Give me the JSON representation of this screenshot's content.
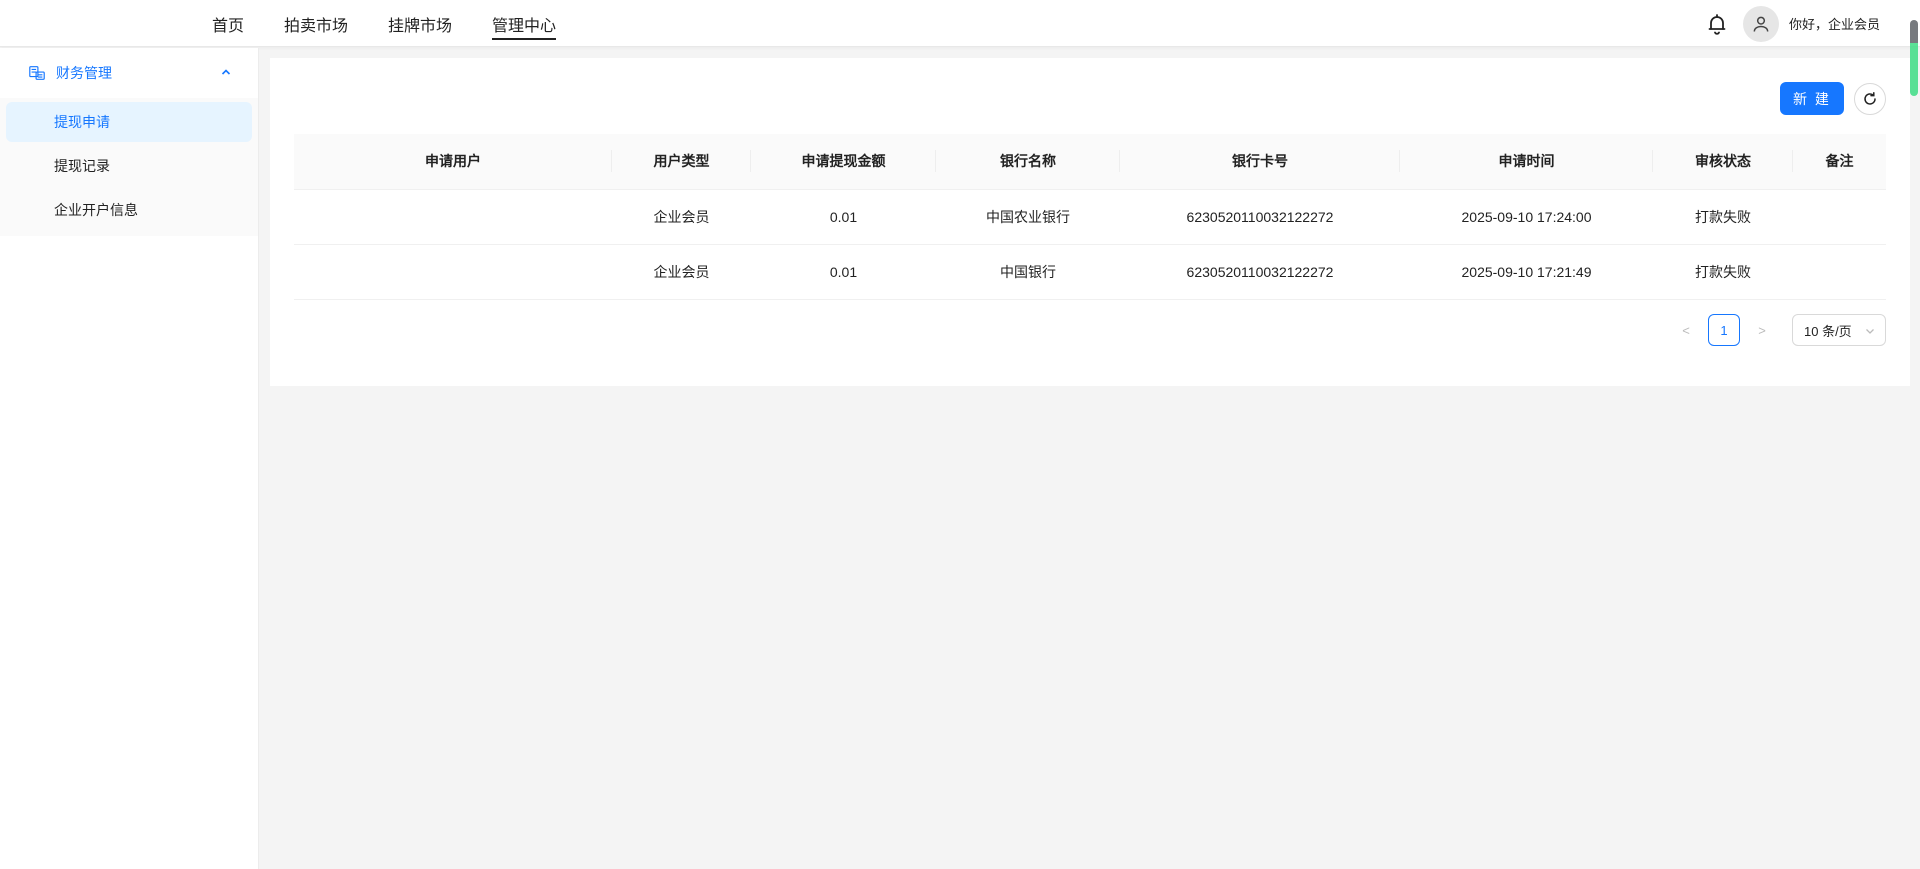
{
  "nav": {
    "items": [
      "首页",
      "拍卖市场",
      "挂牌市场",
      "管理中心"
    ],
    "active_index": 3
  },
  "header": {
    "greeting": "你好，企业会员",
    "bell_icon": "bell-icon",
    "avatar_icon": "user-icon"
  },
  "sidebar": {
    "group": {
      "label": "财务管理",
      "icon": "finance-icon",
      "expanded": true
    },
    "items": [
      "提现申请",
      "提现记录",
      "企业开户信息"
    ],
    "selected_index": 0
  },
  "toolbar": {
    "new_label": "新 建",
    "refresh_icon": "refresh-icon"
  },
  "table": {
    "columns": [
      "申请用户",
      "用户类型",
      "申请提现金额",
      "银行名称",
      "银行卡号",
      "申请时间",
      "审核状态",
      "备注"
    ],
    "rows": [
      [
        "",
        "企业会员",
        "0.01",
        "中国农业银行",
        "6230520110032122272",
        "2025-09-10 17:24:00",
        "打款失败",
        ""
      ],
      [
        "",
        "企业会员",
        "0.01",
        "中国银行",
        "6230520110032122272",
        "2025-09-10 17:21:49",
        "打款失败",
        ""
      ]
    ]
  },
  "pagination": {
    "prev": "<",
    "current": "1",
    "next": ">",
    "page_size": "10 条/页"
  },
  "colors": {
    "primary": "#1677ff",
    "selected_bg": "#e6f4ff",
    "page_bg": "#f4f4f4"
  }
}
